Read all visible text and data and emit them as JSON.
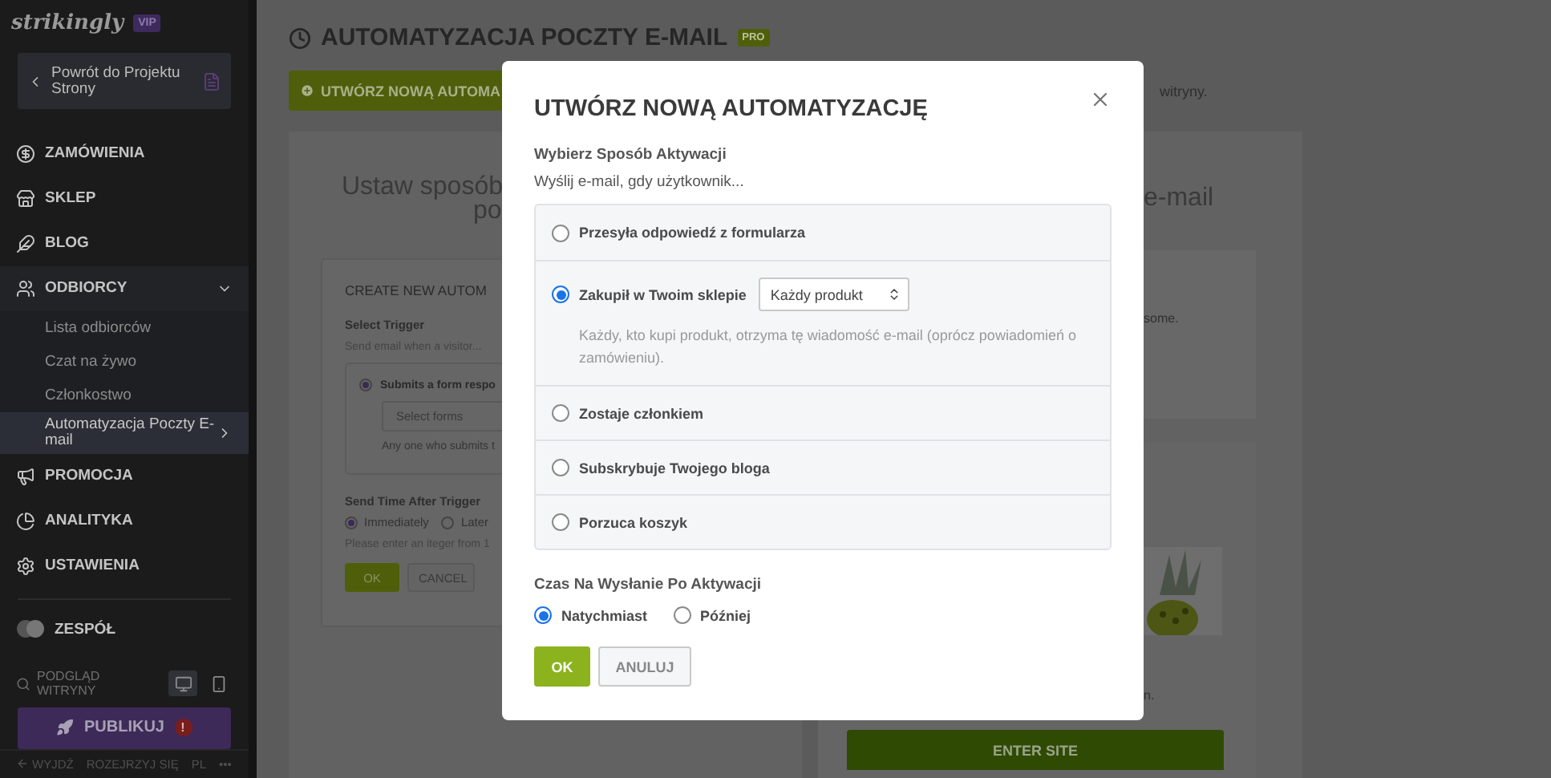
{
  "sidebar": {
    "logo": "strikingly",
    "logo_badge": "VIP",
    "back_button": "Powrót do Projektu Strony",
    "nav": [
      {
        "label": "ZAMÓWIENIA",
        "expanded": false
      },
      {
        "label": "SKLEP",
        "expanded": false
      },
      {
        "label": "BLOG",
        "expanded": false
      },
      {
        "label": "ODBIORCY",
        "expanded": true,
        "children": [
          {
            "label": "Lista odbiorców",
            "selected": false
          },
          {
            "label": "Czat na żywo",
            "selected": false
          },
          {
            "label": "Członkostwo",
            "selected": false
          },
          {
            "label": "Automatyzacja Poczty E-mail",
            "selected": true
          }
        ]
      },
      {
        "label": "PROMOCJA",
        "expanded": false
      },
      {
        "label": "ANALITYKA",
        "expanded": false
      },
      {
        "label": "USTAWIENIA",
        "expanded": false
      }
    ],
    "team": "ZESPÓŁ",
    "preview": "PODGLĄD WITRYNY",
    "devices": [
      {
        "kind": "desktop",
        "selected": true
      },
      {
        "kind": "mobile",
        "selected": false
      }
    ],
    "publish_button": "PUBLIKUJ",
    "publish_alert": "!",
    "footer": [
      "WYJDŹ",
      "ROZEJRZYJ SIĘ",
      "PL",
      "•••"
    ]
  },
  "main": {
    "title": "AUTOMATYZACJA POCZTY E-MAIL",
    "title_badge": "PRO",
    "create_button": "UTWÓRZ NOWĄ AUTOMA",
    "note": "witryny.",
    "left_panel": {
      "heading": [
        "Ustaw sposób",
        "po"
      ],
      "card": {
        "title": "CREATE NEW AUTOM",
        "trigger_label": "Select Trigger",
        "trigger_hint": "Send email when a visitor...",
        "option": {
          "label": "Submits a form respo",
          "selected": true
        },
        "select_placeholder": "Select forms",
        "option_hint": "Any one who submits t",
        "time_label": "Send Time After Trigger",
        "time_options": [
          {
            "label": "Immediately",
            "selected": true
          },
          {
            "label": "Later",
            "selected": false
          }
        ],
        "time_hint": "Please enter an iteger  from 1",
        "ok_button": "OK",
        "cancel_button": "CANCEL"
      }
    },
    "right_panel": {
      "heading": "e-mail",
      "text": "some.",
      "caption": "n.",
      "button": "ENTER SITE"
    }
  },
  "modal": {
    "title": "UTWÓRZ NOWĄ AUTOMATYZACJĘ",
    "section_label": "Wybierz Sposób Aktywacji",
    "hint": "Wyślij e-mail, gdy użytkownik...",
    "triggers": [
      {
        "label": "Przesyła odpowiedź z formularza",
        "selected": false
      },
      {
        "label": "Zakupił w Twoim sklepie",
        "selected": true,
        "select": "Każdy produkt",
        "description": "Każdy, kto kupi produkt, otrzyma tę wiadomość e-mail (oprócz powiadomień o zamówieniu)."
      },
      {
        "label": "Zostaje członkiem",
        "selected": false
      },
      {
        "label": "Subskrybuje Twojego bloga",
        "selected": false
      },
      {
        "label": "Porzuca koszyk",
        "selected": false
      }
    ],
    "time_label": "Czas Na Wysłanie Po Aktywacji",
    "time_options": [
      {
        "label": "Natychmiast",
        "selected": true
      },
      {
        "label": "Później",
        "selected": false
      }
    ],
    "ok_button": "OK",
    "cancel_button": "ANULUJ"
  }
}
